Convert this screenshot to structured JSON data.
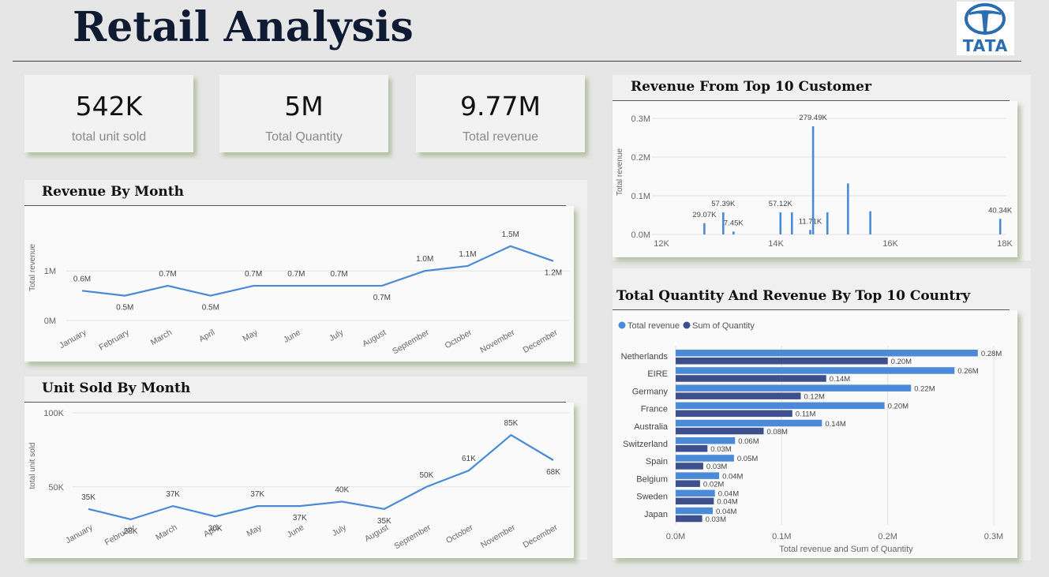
{
  "header": {
    "title": "Retail Analysis",
    "logo_text": "TATA"
  },
  "kpis": [
    {
      "value": "542K",
      "label": "total unit sold"
    },
    {
      "value": "5M",
      "label": "Total Quantity"
    },
    {
      "value": "9.77M",
      "label": "Total revenue"
    }
  ],
  "colors": {
    "primary": "#4a8ad7",
    "secondary": "#3d4f8c",
    "grid": "#e2e2e2",
    "axis_text": "#666666"
  },
  "chart_data": [
    {
      "id": "revenue_by_month",
      "type": "line",
      "title": "Revenue By Month",
      "ylabel": "Total revenue",
      "categories": [
        "January",
        "February",
        "March",
        "April",
        "May",
        "June",
        "July",
        "August",
        "September",
        "October",
        "November",
        "December"
      ],
      "values": [
        0.6,
        0.5,
        0.7,
        0.5,
        0.7,
        0.7,
        0.7,
        0.7,
        1.0,
        1.1,
        1.5,
        1.2
      ],
      "data_labels": [
        "0.6M",
        "0.5M",
        "0.7M",
        "0.5M",
        "0.7M",
        "0.7M",
        "0.7M",
        "0.7M",
        "1.0M",
        "1.1M",
        "1.5M",
        "1.2M"
      ],
      "yticks": [
        "0M",
        "1M"
      ],
      "ylim": [
        0,
        1.8
      ],
      "unit": "M"
    },
    {
      "id": "unit_sold_by_month",
      "type": "line",
      "title": "Unit Sold By Month",
      "ylabel": "total unit sold",
      "categories": [
        "January",
        "February",
        "March",
        "April",
        "May",
        "June",
        "July",
        "August",
        "September",
        "October",
        "November",
        "December"
      ],
      "values": [
        35,
        28,
        37,
        30,
        37,
        37,
        40,
        35,
        50,
        61,
        85,
        68
      ],
      "data_labels": [
        "35K",
        "28K",
        "37K",
        "30K",
        "37K",
        "37K",
        "40K",
        "35K",
        "50K",
        "61K",
        "85K",
        "68K"
      ],
      "yticks": [
        "50K",
        "100K"
      ],
      "ylim": [
        20,
        100
      ],
      "unit": "K"
    },
    {
      "id": "revenue_top10_customer",
      "type": "bar",
      "title": "Revenue From Top 10  Customer",
      "ylabel": "Total revenue",
      "xlim": [
        12000,
        18000
      ],
      "ylim": [
        0,
        0.3
      ],
      "xticks": [
        "12K",
        "14K",
        "16K",
        "18K"
      ],
      "yticks": [
        "0.0M",
        "0.1M",
        "0.2M",
        "0.3M"
      ],
      "points": [
        {
          "x": 12750,
          "y": 0.029,
          "label": "29.07K"
        },
        {
          "x": 13080,
          "y": 0.057,
          "label": "57.39K"
        },
        {
          "x": 13260,
          "y": 0.0075,
          "label": "7.45K"
        },
        {
          "x": 14080,
          "y": 0.057,
          "label": "57.12K"
        },
        {
          "x": 14280,
          "y": 0.057,
          "label": ""
        },
        {
          "x": 14600,
          "y": 0.0117,
          "label": "11.71K"
        },
        {
          "x": 14650,
          "y": 0.2795,
          "label": "279.49K"
        },
        {
          "x": 14900,
          "y": 0.057,
          "label": ""
        },
        {
          "x": 15260,
          "y": 0.132,
          "label": ""
        },
        {
          "x": 15650,
          "y": 0.06,
          "label": ""
        },
        {
          "x": 17920,
          "y": 0.0403,
          "label": "40.34K"
        }
      ]
    },
    {
      "id": "quantity_revenue_by_country",
      "type": "bar",
      "orientation": "horizontal",
      "title": "Total Quantity And Revenue By Top 10 Country",
      "xlabel": "Total revenue and Sum of Quantity",
      "xlim": [
        0,
        0.3
      ],
      "xticks": [
        "0.0M",
        "0.1M",
        "0.2M",
        "0.3M"
      ],
      "categories": [
        "Netherlands",
        "EIRE",
        "Germany",
        "France",
        "Australia",
        "Switzerland",
        "Spain",
        "Belgium",
        "Sweden",
        "Japan"
      ],
      "series": [
        {
          "name": "Total revenue",
          "values": [
            0.285,
            0.263,
            0.222,
            0.197,
            0.138,
            0.056,
            0.055,
            0.041,
            0.037,
            0.035
          ],
          "labels": [
            "0.28M",
            "0.26M",
            "0.22M",
            "0.20M",
            "0.14M",
            "0.06M",
            "0.05M",
            "0.04M",
            "0.04M",
            "0.04M"
          ]
        },
        {
          "name": "Sum of Quantity",
          "values": [
            0.2,
            0.142,
            0.118,
            0.11,
            0.083,
            0.03,
            0.026,
            0.023,
            0.036,
            0.025
          ],
          "labels": [
            "0.20M",
            "0.14M",
            "0.12M",
            "0.11M",
            "0.08M",
            "0.03M",
            "0.03M",
            "0.02M",
            "0.04M",
            "0.03M"
          ]
        }
      ]
    }
  ]
}
